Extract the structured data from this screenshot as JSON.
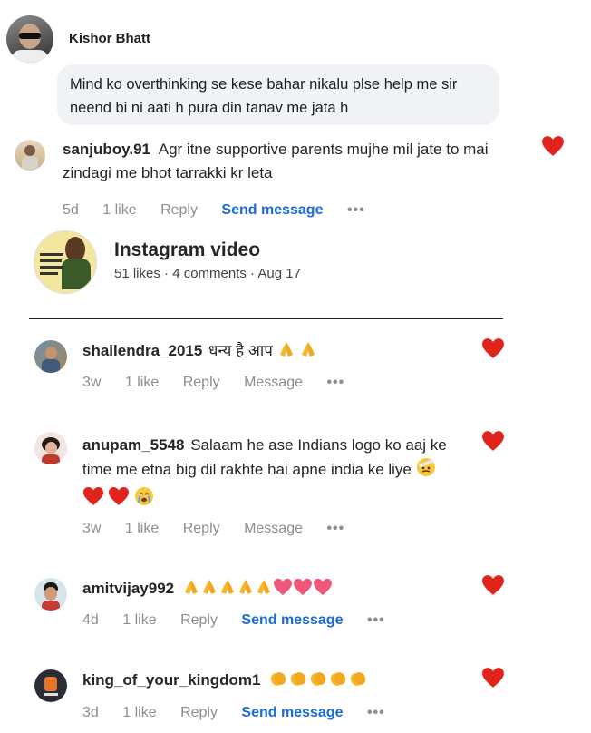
{
  "fb_comment": {
    "author": "Kishor Bhatt",
    "text": "Mind ko overthinking se kese bahar nikalu plse help me sir neend bi ni aati h pura din tanav me jata h"
  },
  "ig_comment": {
    "username": "sanjuboy.91",
    "text": "Agr itne supportive parents mujhe mil jate to mai zindagi me bhot tarrakki kr leta",
    "time": "5d",
    "likes": "1 like",
    "reply": "Reply",
    "action": "Send message",
    "more": "•••"
  },
  "video": {
    "title": "Instagram video",
    "meta": "51 likes · 4 comments · Aug 17"
  },
  "comments": [
    {
      "username": "shailendra_2015",
      "text": "धन्य है आप",
      "time": "3w",
      "likes": "1 like",
      "reply": "Reply",
      "action": "Message",
      "more": "•••",
      "emoji": [
        "pray",
        "pray"
      ]
    },
    {
      "username": "anupam_5548",
      "text": "Salaam he ase Indians logo ko aaj ke time me etna big dil rakhte hai apne india ke liye",
      "time": "3w",
      "likes": "1 like",
      "reply": "Reply",
      "action": "Message",
      "more": "•••",
      "emoji": [
        "face",
        "heart",
        "heart",
        "cry"
      ]
    },
    {
      "username": "amitvijay992",
      "text": "",
      "time": "4d",
      "likes": "1 like",
      "reply": "Reply",
      "action": "Send message",
      "more": "•••",
      "emoji": [
        "pray",
        "pray",
        "pray",
        "pray",
        "pray",
        "pink-heart",
        "pink-heart",
        "pink-heart"
      ]
    },
    {
      "username": "king_of_your_kingdom1",
      "text": "",
      "time": "3d",
      "likes": "1 like",
      "reply": "Reply",
      "action": "Send message",
      "more": "•••",
      "emoji": [
        "clap",
        "clap",
        "clap",
        "clap",
        "clap"
      ]
    }
  ],
  "colors": {
    "heart": "#e0241d",
    "link": "#1b6bd8",
    "muted": "#8e8e8e",
    "bubble": "#f0f2f5"
  }
}
